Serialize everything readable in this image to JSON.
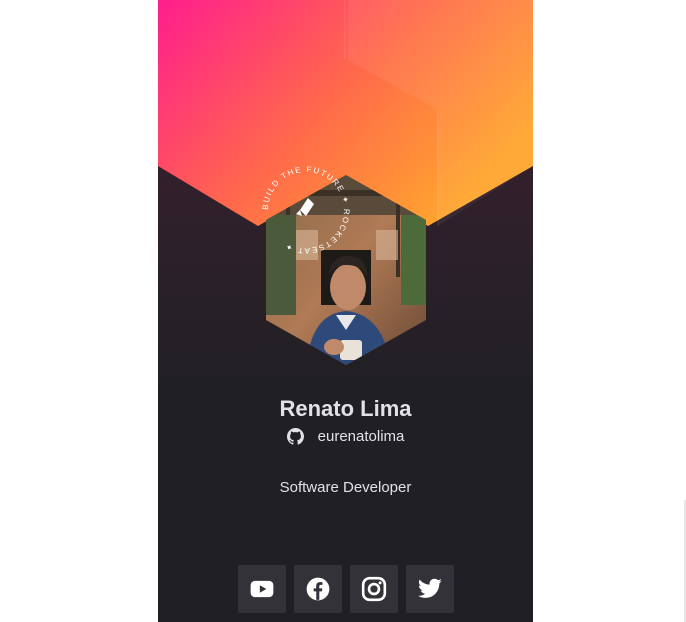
{
  "profile": {
    "name": "Renato Lima",
    "github_user": "eurenatolima",
    "role": "Software Developer"
  },
  "stamp": {
    "text": "BUILD THE FUTURE ✦ ROCKETSEAT ✦"
  },
  "social": [
    {
      "name": "youtube",
      "icon": "youtube-icon"
    },
    {
      "name": "facebook",
      "icon": "facebook-icon"
    },
    {
      "name": "instagram",
      "icon": "instagram-icon"
    },
    {
      "name": "twitter",
      "icon": "twitter-icon"
    }
  ],
  "colors": {
    "background": "#202024",
    "gradient_start": "#FF1D8E",
    "gradient_end": "#FFA52E",
    "text": "#E1E1E6",
    "button": "#323238"
  }
}
